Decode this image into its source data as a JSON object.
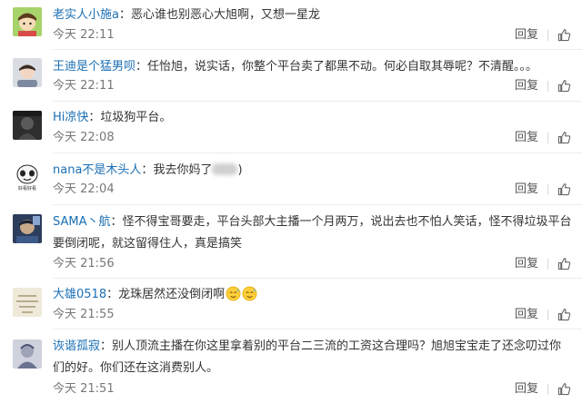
{
  "actions": {
    "reply_label": "回复"
  },
  "comments": [
    {
      "user": "老实人小施a",
      "colon": "：",
      "text": "恶心谁也别恶心大旭啊，又想一星龙",
      "time": "今天 22:11"
    },
    {
      "user": "王迪是个猛男呗",
      "colon": "：",
      "text": "任怡旭，说实话，你整个平台卖了都黑不动。何必自取其辱呢？不清醒。。。",
      "time": "今天 22:11"
    },
    {
      "user": "Hi凉快",
      "colon": "：",
      "text": "垃圾狗平台。",
      "time": "今天 22:08"
    },
    {
      "user": "nana不是木头人",
      "colon": "：",
      "text": "我去你妈了",
      "text_tail": ")",
      "time": "今天 22:04",
      "avatar_caption": "好看好看"
    },
    {
      "user": "SAMA丶航",
      "colon": "：",
      "text": "怪不得宝哥要走，平台头部大主播一个月两万，说出去也不怕人笑话，怪不得垃圾平台要倒闭呢，就这留得住人，真是搞笑",
      "time": "今天 21:56"
    },
    {
      "user": "大雄0518",
      "colon": "：",
      "text": "龙珠居然还没倒闭啊",
      "time": "今天 21:55"
    },
    {
      "user": "诙谐孤寂",
      "colon": "：",
      "text": "别人顶流主播在你这里拿着别的平台二三流的工资这合理吗？旭旭宝宝走了还念叨过你们的好。你们还在这消费别人。",
      "time": "今天 21:51"
    }
  ],
  "colors": {
    "username": "#1a6fb5",
    "text": "#333333",
    "meta": "#777777",
    "divider": "#ececec"
  },
  "icons": {
    "like": "thumbs-up-icon",
    "emoji": "sweat-smile-emoji"
  }
}
